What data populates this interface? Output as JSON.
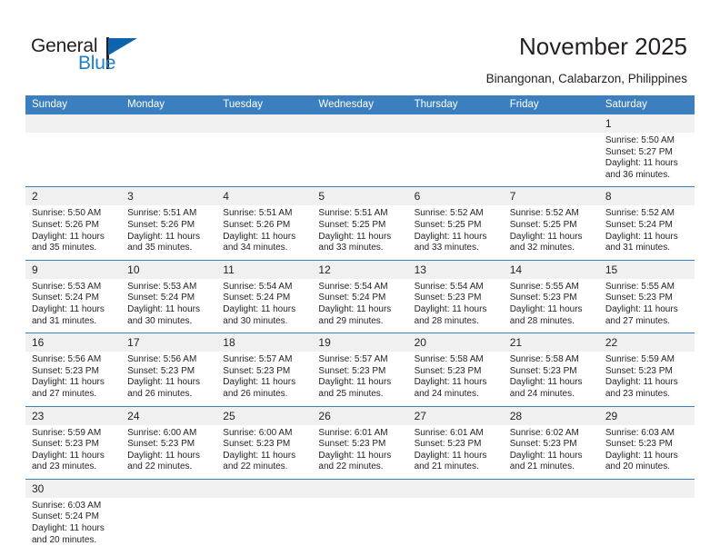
{
  "brand": {
    "name_part1": "General",
    "name_part2": "Blue",
    "logo_icon": "triangle-flag-logo",
    "accent_color": "#1f7fc4",
    "logo_triangle_color": "#0b64ad"
  },
  "header": {
    "title": "November 2025",
    "subtitle": "Binangonan, Calabarzon, Philippines"
  },
  "theme": {
    "header_blue": "#3c7fbe",
    "daynum_band": "#f0f0f0",
    "text": "#231f20"
  },
  "weekdays": [
    "Sunday",
    "Monday",
    "Tuesday",
    "Wednesday",
    "Thursday",
    "Friday",
    "Saturday"
  ],
  "weeks": [
    {
      "days": [
        {
          "num": "",
          "sunrise": "",
          "sunset": "",
          "daylight1": "",
          "daylight2": "",
          "empty": true
        },
        {
          "num": "",
          "sunrise": "",
          "sunset": "",
          "daylight1": "",
          "daylight2": "",
          "empty": true
        },
        {
          "num": "",
          "sunrise": "",
          "sunset": "",
          "daylight1": "",
          "daylight2": "",
          "empty": true
        },
        {
          "num": "",
          "sunrise": "",
          "sunset": "",
          "daylight1": "",
          "daylight2": "",
          "empty": true
        },
        {
          "num": "",
          "sunrise": "",
          "sunset": "",
          "daylight1": "",
          "daylight2": "",
          "empty": true
        },
        {
          "num": "",
          "sunrise": "",
          "sunset": "",
          "daylight1": "",
          "daylight2": "",
          "empty": true
        },
        {
          "num": "1",
          "sunrise": "Sunrise: 5:50 AM",
          "sunset": "Sunset: 5:27 PM",
          "daylight1": "Daylight: 11 hours",
          "daylight2": "and 36 minutes.",
          "empty": false
        }
      ]
    },
    {
      "days": [
        {
          "num": "2",
          "sunrise": "Sunrise: 5:50 AM",
          "sunset": "Sunset: 5:26 PM",
          "daylight1": "Daylight: 11 hours",
          "daylight2": "and 35 minutes.",
          "empty": false
        },
        {
          "num": "3",
          "sunrise": "Sunrise: 5:51 AM",
          "sunset": "Sunset: 5:26 PM",
          "daylight1": "Daylight: 11 hours",
          "daylight2": "and 35 minutes.",
          "empty": false
        },
        {
          "num": "4",
          "sunrise": "Sunrise: 5:51 AM",
          "sunset": "Sunset: 5:26 PM",
          "daylight1": "Daylight: 11 hours",
          "daylight2": "and 34 minutes.",
          "empty": false
        },
        {
          "num": "5",
          "sunrise": "Sunrise: 5:51 AM",
          "sunset": "Sunset: 5:25 PM",
          "daylight1": "Daylight: 11 hours",
          "daylight2": "and 33 minutes.",
          "empty": false
        },
        {
          "num": "6",
          "sunrise": "Sunrise: 5:52 AM",
          "sunset": "Sunset: 5:25 PM",
          "daylight1": "Daylight: 11 hours",
          "daylight2": "and 33 minutes.",
          "empty": false
        },
        {
          "num": "7",
          "sunrise": "Sunrise: 5:52 AM",
          "sunset": "Sunset: 5:25 PM",
          "daylight1": "Daylight: 11 hours",
          "daylight2": "and 32 minutes.",
          "empty": false
        },
        {
          "num": "8",
          "sunrise": "Sunrise: 5:52 AM",
          "sunset": "Sunset: 5:24 PM",
          "daylight1": "Daylight: 11 hours",
          "daylight2": "and 31 minutes.",
          "empty": false
        }
      ]
    },
    {
      "days": [
        {
          "num": "9",
          "sunrise": "Sunrise: 5:53 AM",
          "sunset": "Sunset: 5:24 PM",
          "daylight1": "Daylight: 11 hours",
          "daylight2": "and 31 minutes.",
          "empty": false
        },
        {
          "num": "10",
          "sunrise": "Sunrise: 5:53 AM",
          "sunset": "Sunset: 5:24 PM",
          "daylight1": "Daylight: 11 hours",
          "daylight2": "and 30 minutes.",
          "empty": false
        },
        {
          "num": "11",
          "sunrise": "Sunrise: 5:54 AM",
          "sunset": "Sunset: 5:24 PM",
          "daylight1": "Daylight: 11 hours",
          "daylight2": "and 30 minutes.",
          "empty": false
        },
        {
          "num": "12",
          "sunrise": "Sunrise: 5:54 AM",
          "sunset": "Sunset: 5:24 PM",
          "daylight1": "Daylight: 11 hours",
          "daylight2": "and 29 minutes.",
          "empty": false
        },
        {
          "num": "13",
          "sunrise": "Sunrise: 5:54 AM",
          "sunset": "Sunset: 5:23 PM",
          "daylight1": "Daylight: 11 hours",
          "daylight2": "and 28 minutes.",
          "empty": false
        },
        {
          "num": "14",
          "sunrise": "Sunrise: 5:55 AM",
          "sunset": "Sunset: 5:23 PM",
          "daylight1": "Daylight: 11 hours",
          "daylight2": "and 28 minutes.",
          "empty": false
        },
        {
          "num": "15",
          "sunrise": "Sunrise: 5:55 AM",
          "sunset": "Sunset: 5:23 PM",
          "daylight1": "Daylight: 11 hours",
          "daylight2": "and 27 minutes.",
          "empty": false
        }
      ]
    },
    {
      "days": [
        {
          "num": "16",
          "sunrise": "Sunrise: 5:56 AM",
          "sunset": "Sunset: 5:23 PM",
          "daylight1": "Daylight: 11 hours",
          "daylight2": "and 27 minutes.",
          "empty": false
        },
        {
          "num": "17",
          "sunrise": "Sunrise: 5:56 AM",
          "sunset": "Sunset: 5:23 PM",
          "daylight1": "Daylight: 11 hours",
          "daylight2": "and 26 minutes.",
          "empty": false
        },
        {
          "num": "18",
          "sunrise": "Sunrise: 5:57 AM",
          "sunset": "Sunset: 5:23 PM",
          "daylight1": "Daylight: 11 hours",
          "daylight2": "and 26 minutes.",
          "empty": false
        },
        {
          "num": "19",
          "sunrise": "Sunrise: 5:57 AM",
          "sunset": "Sunset: 5:23 PM",
          "daylight1": "Daylight: 11 hours",
          "daylight2": "and 25 minutes.",
          "empty": false
        },
        {
          "num": "20",
          "sunrise": "Sunrise: 5:58 AM",
          "sunset": "Sunset: 5:23 PM",
          "daylight1": "Daylight: 11 hours",
          "daylight2": "and 24 minutes.",
          "empty": false
        },
        {
          "num": "21",
          "sunrise": "Sunrise: 5:58 AM",
          "sunset": "Sunset: 5:23 PM",
          "daylight1": "Daylight: 11 hours",
          "daylight2": "and 24 minutes.",
          "empty": false
        },
        {
          "num": "22",
          "sunrise": "Sunrise: 5:59 AM",
          "sunset": "Sunset: 5:23 PM",
          "daylight1": "Daylight: 11 hours",
          "daylight2": "and 23 minutes.",
          "empty": false
        }
      ]
    },
    {
      "days": [
        {
          "num": "23",
          "sunrise": "Sunrise: 5:59 AM",
          "sunset": "Sunset: 5:23 PM",
          "daylight1": "Daylight: 11 hours",
          "daylight2": "and 23 minutes.",
          "empty": false
        },
        {
          "num": "24",
          "sunrise": "Sunrise: 6:00 AM",
          "sunset": "Sunset: 5:23 PM",
          "daylight1": "Daylight: 11 hours",
          "daylight2": "and 22 minutes.",
          "empty": false
        },
        {
          "num": "25",
          "sunrise": "Sunrise: 6:00 AM",
          "sunset": "Sunset: 5:23 PM",
          "daylight1": "Daylight: 11 hours",
          "daylight2": "and 22 minutes.",
          "empty": false
        },
        {
          "num": "26",
          "sunrise": "Sunrise: 6:01 AM",
          "sunset": "Sunset: 5:23 PM",
          "daylight1": "Daylight: 11 hours",
          "daylight2": "and 22 minutes.",
          "empty": false
        },
        {
          "num": "27",
          "sunrise": "Sunrise: 6:01 AM",
          "sunset": "Sunset: 5:23 PM",
          "daylight1": "Daylight: 11 hours",
          "daylight2": "and 21 minutes.",
          "empty": false
        },
        {
          "num": "28",
          "sunrise": "Sunrise: 6:02 AM",
          "sunset": "Sunset: 5:23 PM",
          "daylight1": "Daylight: 11 hours",
          "daylight2": "and 21 minutes.",
          "empty": false
        },
        {
          "num": "29",
          "sunrise": "Sunrise: 6:03 AM",
          "sunset": "Sunset: 5:23 PM",
          "daylight1": "Daylight: 11 hours",
          "daylight2": "and 20 minutes.",
          "empty": false
        }
      ]
    },
    {
      "days": [
        {
          "num": "30",
          "sunrise": "Sunrise: 6:03 AM",
          "sunset": "Sunset: 5:24 PM",
          "daylight1": "Daylight: 11 hours",
          "daylight2": "and 20 minutes.",
          "empty": false
        },
        {
          "num": "",
          "sunrise": "",
          "sunset": "",
          "daylight1": "",
          "daylight2": "",
          "empty": true
        },
        {
          "num": "",
          "sunrise": "",
          "sunset": "",
          "daylight1": "",
          "daylight2": "",
          "empty": true
        },
        {
          "num": "",
          "sunrise": "",
          "sunset": "",
          "daylight1": "",
          "daylight2": "",
          "empty": true
        },
        {
          "num": "",
          "sunrise": "",
          "sunset": "",
          "daylight1": "",
          "daylight2": "",
          "empty": true
        },
        {
          "num": "",
          "sunrise": "",
          "sunset": "",
          "daylight1": "",
          "daylight2": "",
          "empty": true
        },
        {
          "num": "",
          "sunrise": "",
          "sunset": "",
          "daylight1": "",
          "daylight2": "",
          "empty": true
        }
      ]
    }
  ]
}
